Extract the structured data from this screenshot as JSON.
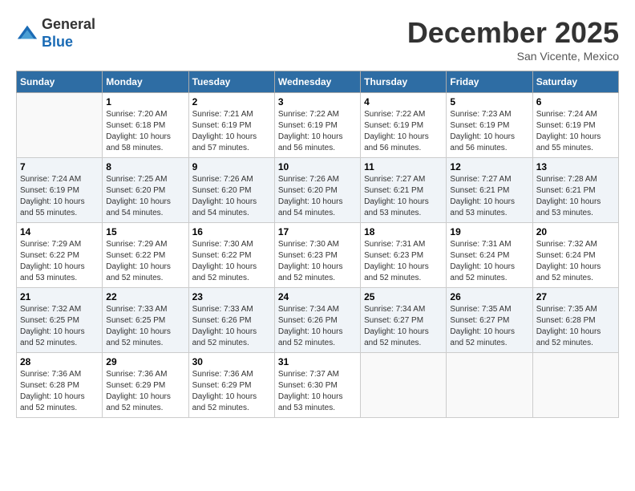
{
  "logo": {
    "general": "General",
    "blue": "Blue"
  },
  "header": {
    "month": "December 2025",
    "location": "San Vicente, Mexico"
  },
  "weekdays": [
    "Sunday",
    "Monday",
    "Tuesday",
    "Wednesday",
    "Thursday",
    "Friday",
    "Saturday"
  ],
  "weeks": [
    [
      {
        "day": null,
        "info": null
      },
      {
        "day": "1",
        "info": "Sunrise: 7:20 AM\nSunset: 6:18 PM\nDaylight: 10 hours\nand 58 minutes."
      },
      {
        "day": "2",
        "info": "Sunrise: 7:21 AM\nSunset: 6:19 PM\nDaylight: 10 hours\nand 57 minutes."
      },
      {
        "day": "3",
        "info": "Sunrise: 7:22 AM\nSunset: 6:19 PM\nDaylight: 10 hours\nand 56 minutes."
      },
      {
        "day": "4",
        "info": "Sunrise: 7:22 AM\nSunset: 6:19 PM\nDaylight: 10 hours\nand 56 minutes."
      },
      {
        "day": "5",
        "info": "Sunrise: 7:23 AM\nSunset: 6:19 PM\nDaylight: 10 hours\nand 56 minutes."
      },
      {
        "day": "6",
        "info": "Sunrise: 7:24 AM\nSunset: 6:19 PM\nDaylight: 10 hours\nand 55 minutes."
      }
    ],
    [
      {
        "day": "7",
        "info": "Sunrise: 7:24 AM\nSunset: 6:19 PM\nDaylight: 10 hours\nand 55 minutes."
      },
      {
        "day": "8",
        "info": "Sunrise: 7:25 AM\nSunset: 6:20 PM\nDaylight: 10 hours\nand 54 minutes."
      },
      {
        "day": "9",
        "info": "Sunrise: 7:26 AM\nSunset: 6:20 PM\nDaylight: 10 hours\nand 54 minutes."
      },
      {
        "day": "10",
        "info": "Sunrise: 7:26 AM\nSunset: 6:20 PM\nDaylight: 10 hours\nand 54 minutes."
      },
      {
        "day": "11",
        "info": "Sunrise: 7:27 AM\nSunset: 6:21 PM\nDaylight: 10 hours\nand 53 minutes."
      },
      {
        "day": "12",
        "info": "Sunrise: 7:27 AM\nSunset: 6:21 PM\nDaylight: 10 hours\nand 53 minutes."
      },
      {
        "day": "13",
        "info": "Sunrise: 7:28 AM\nSunset: 6:21 PM\nDaylight: 10 hours\nand 53 minutes."
      }
    ],
    [
      {
        "day": "14",
        "info": "Sunrise: 7:29 AM\nSunset: 6:22 PM\nDaylight: 10 hours\nand 53 minutes."
      },
      {
        "day": "15",
        "info": "Sunrise: 7:29 AM\nSunset: 6:22 PM\nDaylight: 10 hours\nand 52 minutes."
      },
      {
        "day": "16",
        "info": "Sunrise: 7:30 AM\nSunset: 6:22 PM\nDaylight: 10 hours\nand 52 minutes."
      },
      {
        "day": "17",
        "info": "Sunrise: 7:30 AM\nSunset: 6:23 PM\nDaylight: 10 hours\nand 52 minutes."
      },
      {
        "day": "18",
        "info": "Sunrise: 7:31 AM\nSunset: 6:23 PM\nDaylight: 10 hours\nand 52 minutes."
      },
      {
        "day": "19",
        "info": "Sunrise: 7:31 AM\nSunset: 6:24 PM\nDaylight: 10 hours\nand 52 minutes."
      },
      {
        "day": "20",
        "info": "Sunrise: 7:32 AM\nSunset: 6:24 PM\nDaylight: 10 hours\nand 52 minutes."
      }
    ],
    [
      {
        "day": "21",
        "info": "Sunrise: 7:32 AM\nSunset: 6:25 PM\nDaylight: 10 hours\nand 52 minutes."
      },
      {
        "day": "22",
        "info": "Sunrise: 7:33 AM\nSunset: 6:25 PM\nDaylight: 10 hours\nand 52 minutes."
      },
      {
        "day": "23",
        "info": "Sunrise: 7:33 AM\nSunset: 6:26 PM\nDaylight: 10 hours\nand 52 minutes."
      },
      {
        "day": "24",
        "info": "Sunrise: 7:34 AM\nSunset: 6:26 PM\nDaylight: 10 hours\nand 52 minutes."
      },
      {
        "day": "25",
        "info": "Sunrise: 7:34 AM\nSunset: 6:27 PM\nDaylight: 10 hours\nand 52 minutes."
      },
      {
        "day": "26",
        "info": "Sunrise: 7:35 AM\nSunset: 6:27 PM\nDaylight: 10 hours\nand 52 minutes."
      },
      {
        "day": "27",
        "info": "Sunrise: 7:35 AM\nSunset: 6:28 PM\nDaylight: 10 hours\nand 52 minutes."
      }
    ],
    [
      {
        "day": "28",
        "info": "Sunrise: 7:36 AM\nSunset: 6:28 PM\nDaylight: 10 hours\nand 52 minutes."
      },
      {
        "day": "29",
        "info": "Sunrise: 7:36 AM\nSunset: 6:29 PM\nDaylight: 10 hours\nand 52 minutes."
      },
      {
        "day": "30",
        "info": "Sunrise: 7:36 AM\nSunset: 6:29 PM\nDaylight: 10 hours\nand 52 minutes."
      },
      {
        "day": "31",
        "info": "Sunrise: 7:37 AM\nSunset: 6:30 PM\nDaylight: 10 hours\nand 53 minutes."
      },
      {
        "day": null,
        "info": null
      },
      {
        "day": null,
        "info": null
      },
      {
        "day": null,
        "info": null
      }
    ]
  ]
}
